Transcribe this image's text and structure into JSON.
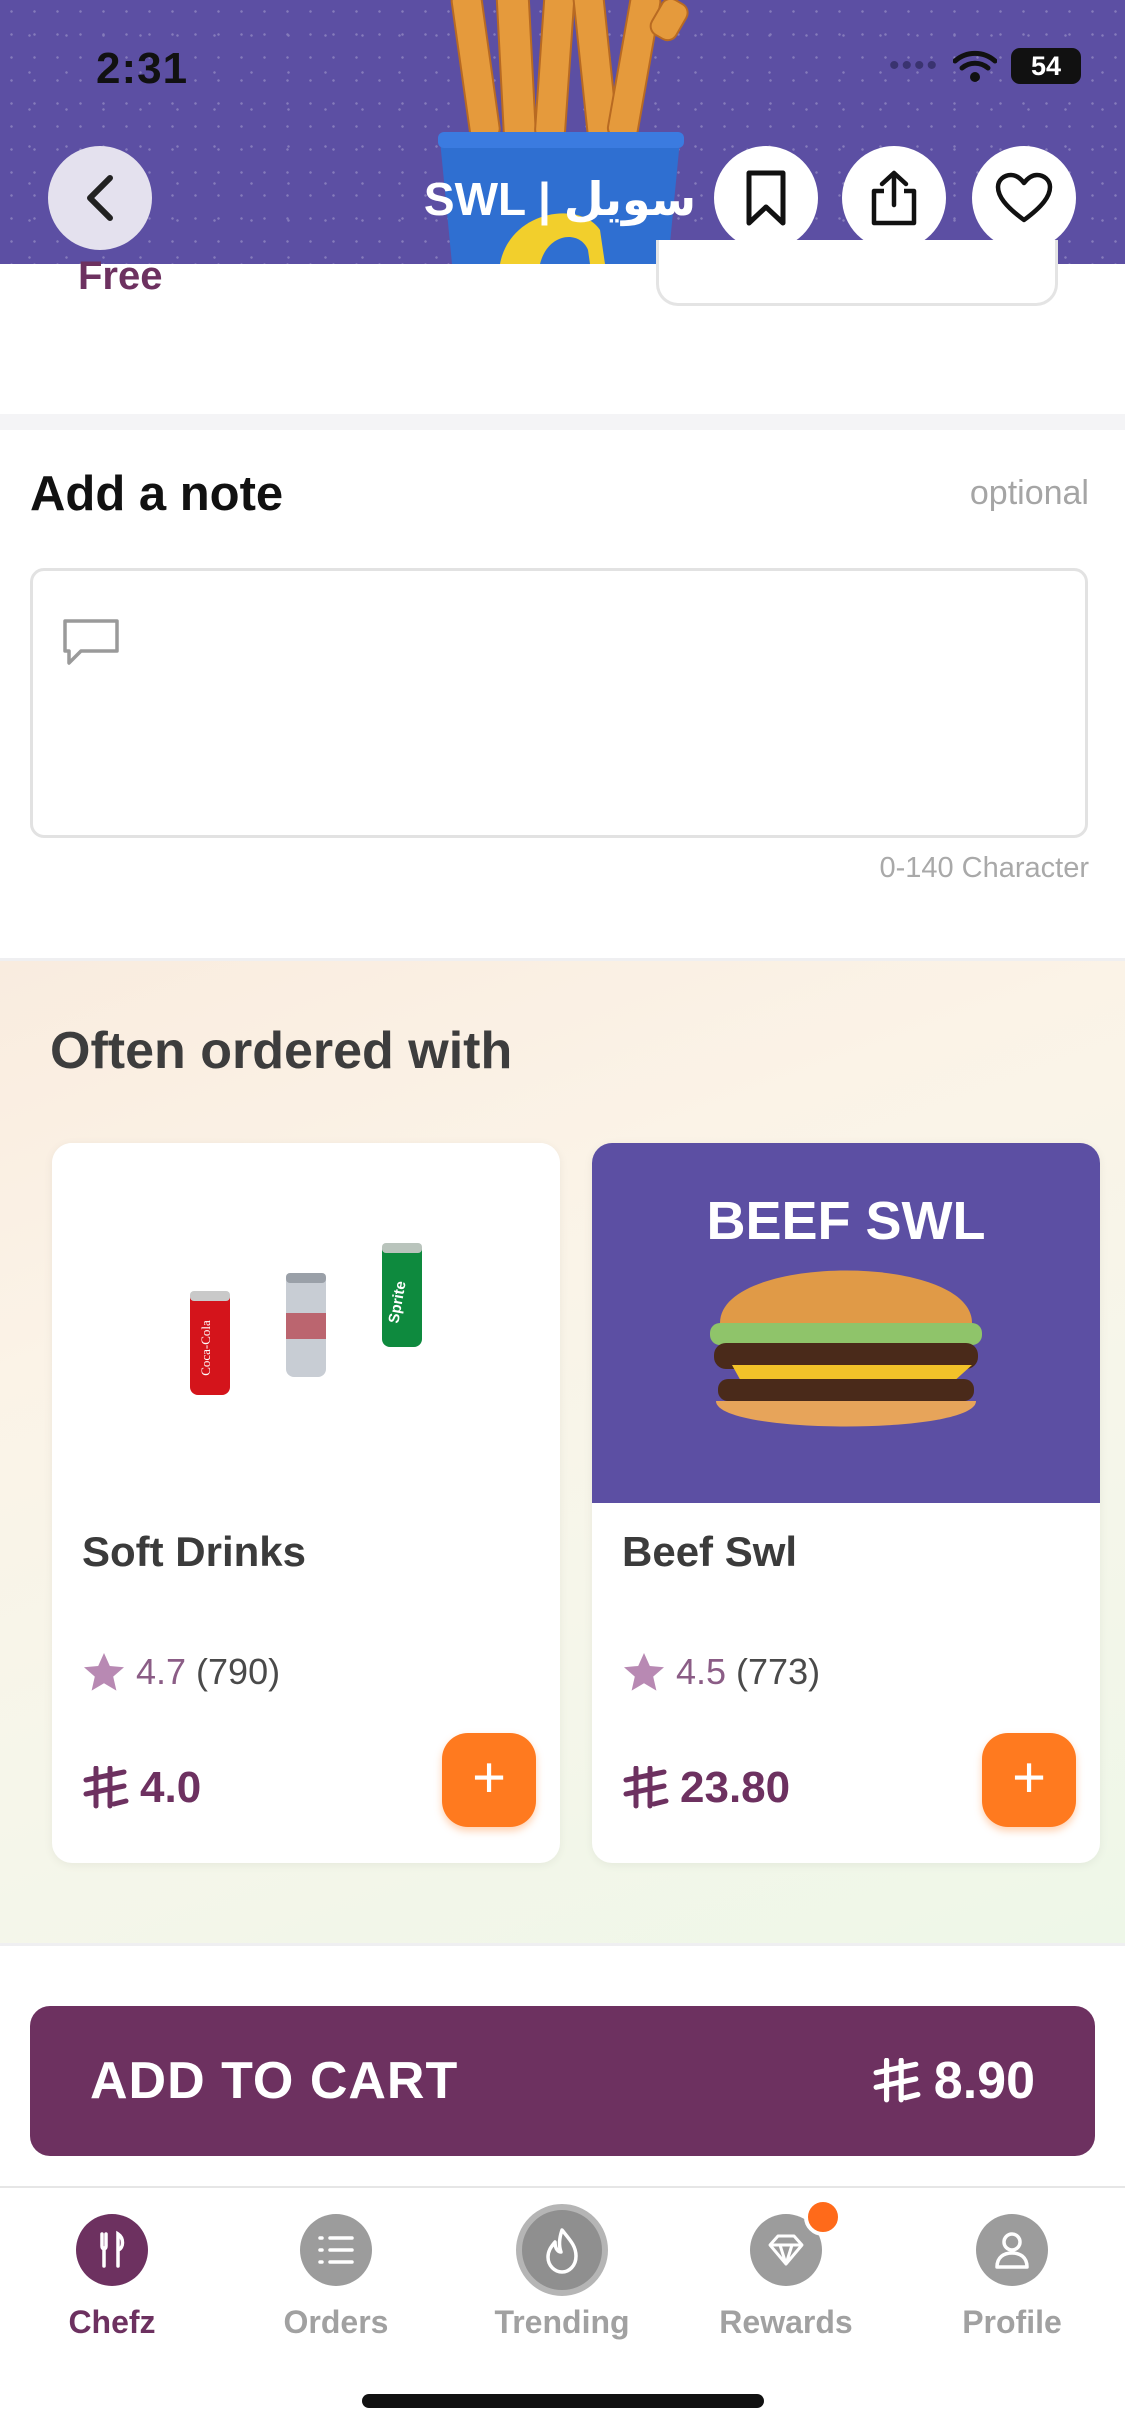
{
  "status_bar": {
    "time": "2:31",
    "battery": "54"
  },
  "header": {
    "title": "SWL | سويل"
  },
  "delivery": {
    "fee_label": "Free"
  },
  "note": {
    "title": "Add a note",
    "optional_label": "optional",
    "placeholder": "",
    "counter": "0-140 Character"
  },
  "often_ordered": {
    "title": "Often ordered with",
    "items": [
      {
        "name": "Soft Drinks",
        "rating": "4.7",
        "reviews": "(790)",
        "price": "4.0",
        "image_text": ""
      },
      {
        "name": "Beef Swl",
        "rating": "4.5",
        "reviews": "(773)",
        "price": "23.80",
        "image_text": "BEEF SWL"
      }
    ]
  },
  "cart": {
    "label": "ADD TO CART",
    "price": "8.90"
  },
  "nav": {
    "items": [
      {
        "label": "Chefz",
        "icon": "fork-knife-icon",
        "active": true
      },
      {
        "label": "Orders",
        "icon": "list-icon",
        "active": false
      },
      {
        "label": "Trending",
        "icon": "flame-icon",
        "active": false
      },
      {
        "label": "Rewards",
        "icon": "diamond-icon",
        "active": false
      },
      {
        "label": "Profile",
        "icon": "person-icon",
        "active": false
      }
    ]
  },
  "colors": {
    "brand": "#6d3160",
    "accent": "#ff7a1f",
    "header_bg": "#5c4fa3",
    "star": "#b889b3"
  }
}
